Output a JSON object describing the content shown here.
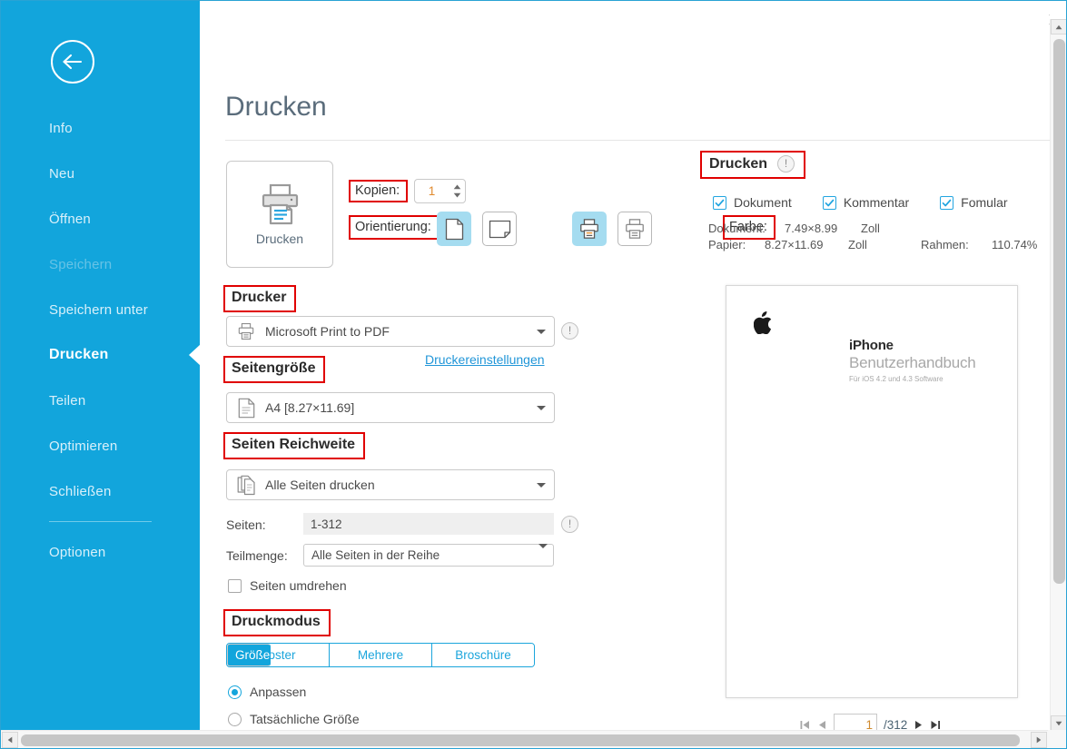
{
  "window": {
    "minimize": "—",
    "maximize": "□",
    "close": "✕",
    "accent_color": "#12a5dc"
  },
  "sidebar": {
    "back_icon": "back-arrow-icon",
    "items": [
      {
        "label": "Info",
        "state": "normal"
      },
      {
        "label": "Neu",
        "state": "normal"
      },
      {
        "label": "Öffnen",
        "state": "normal"
      },
      {
        "label": "Speichern",
        "state": "disabled"
      },
      {
        "label": "Speichern unter",
        "state": "normal"
      },
      {
        "label": "Drucken",
        "state": "active"
      },
      {
        "label": "Teilen",
        "state": "normal"
      },
      {
        "label": "Optimieren",
        "state": "normal"
      },
      {
        "label": "Schließen",
        "state": "normal"
      },
      {
        "label": "Optionen",
        "state": "normal"
      }
    ]
  },
  "main": {
    "page_title": "Drucken",
    "print_button": {
      "label": "Drucken",
      "icon": "printer-icon"
    },
    "copies": {
      "label": "Kopien:",
      "value": "1"
    },
    "orientation": {
      "label": "Orientierung:",
      "options": [
        {
          "icon": "portrait-page-icon",
          "selected": true
        },
        {
          "icon": "landscape-page-icon",
          "selected": false
        }
      ]
    },
    "color": {
      "label": "Farbe:",
      "options": [
        {
          "icon": "color-printer-icon",
          "selected": true
        },
        {
          "icon": "grayscale-printer-icon",
          "selected": false
        }
      ]
    },
    "printer": {
      "heading": "Drucker",
      "value": "Microsoft Print to PDF",
      "icon": "printer-small-icon",
      "info_icon": "info-icon",
      "settings_link": "Druckereinstellungen"
    },
    "page_size": {
      "heading": "Seitengröße",
      "value": "A4 [8.27×11.69]",
      "icon": "page-icon"
    },
    "page_range": {
      "heading": "Seiten Reichweite",
      "mode_value": "Alle Seiten drucken",
      "mode_icon": "pages-stack-icon",
      "pages_label": "Seiten:",
      "pages_value": "1-312",
      "pages_info_icon": "info-icon",
      "subset_label": "Teilmenge:",
      "subset_value": "Alle Seiten in der Reihe",
      "reverse_label": "Seiten umdrehen",
      "reverse_checked": false
    },
    "print_mode": {
      "heading": "Druckmodus",
      "tabs": [
        {
          "label": "Größe",
          "selected": true
        },
        {
          "label": "Poster",
          "selected": false
        },
        {
          "label": "Mehrere",
          "selected": false
        },
        {
          "label": "Broschüre",
          "selected": false
        }
      ],
      "radios": [
        {
          "label": "Anpassen",
          "selected": true
        },
        {
          "label": "Tatsächliche Größe",
          "selected": false
        }
      ]
    }
  },
  "right_panel": {
    "heading": "Drucken",
    "heading_info_icon": "info-icon",
    "checks": [
      {
        "label": "Dokument",
        "checked": true
      },
      {
        "label": "Kommentar",
        "checked": true
      },
      {
        "label": "Fomular",
        "checked": true
      }
    ],
    "meta": {
      "document_label": "Dokument:",
      "document_size": "7.49×8.99",
      "document_unit": "Zoll",
      "paper_label": "Papier:",
      "paper_size": "8.27×11.69",
      "paper_unit": "Zoll",
      "scale_label": "Rahmen:",
      "scale_value": "110.74%"
    },
    "preview": {
      "apple_icon": "apple-logo-icon",
      "title": "iPhone",
      "subtitle": "Benutzerhandbuch",
      "caption": "Für iOS 4.2 und 4.3 Software"
    },
    "pager": {
      "first_icon": "first-page-icon",
      "prev_icon": "prev-page-icon",
      "current": "1",
      "total": "/312",
      "next_icon": "next-page-icon",
      "last_icon": "last-page-icon"
    }
  }
}
